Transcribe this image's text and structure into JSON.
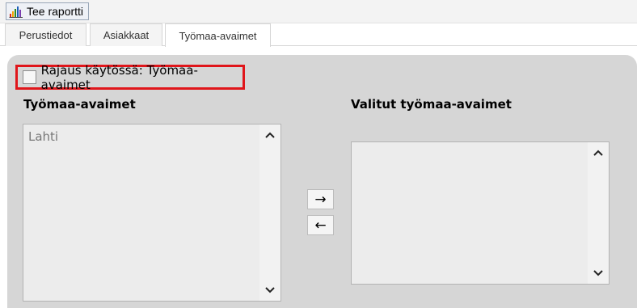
{
  "toolbar": {
    "report_button_label": "Tee raportti",
    "report_icon": "bar-chart-icon"
  },
  "tabs": [
    {
      "label": "Perustiedot",
      "active": false
    },
    {
      "label": "Asiakkaat",
      "active": false
    },
    {
      "label": "Työmaa-avaimet",
      "active": true
    }
  ],
  "filter": {
    "label": "Rajaus käytössä: Työmaa-avaimet",
    "checked": false,
    "highlight_color": "#e0161b"
  },
  "available": {
    "title": "Työmaa-avaimet",
    "items": [
      "Lahti"
    ]
  },
  "selected": {
    "title": "Valitut työmaa-avaimet",
    "items": []
  },
  "buttons": {
    "add": "→",
    "remove": "←"
  },
  "colors": {
    "panel": "#d6d6d6",
    "listbox": "#ececec"
  }
}
